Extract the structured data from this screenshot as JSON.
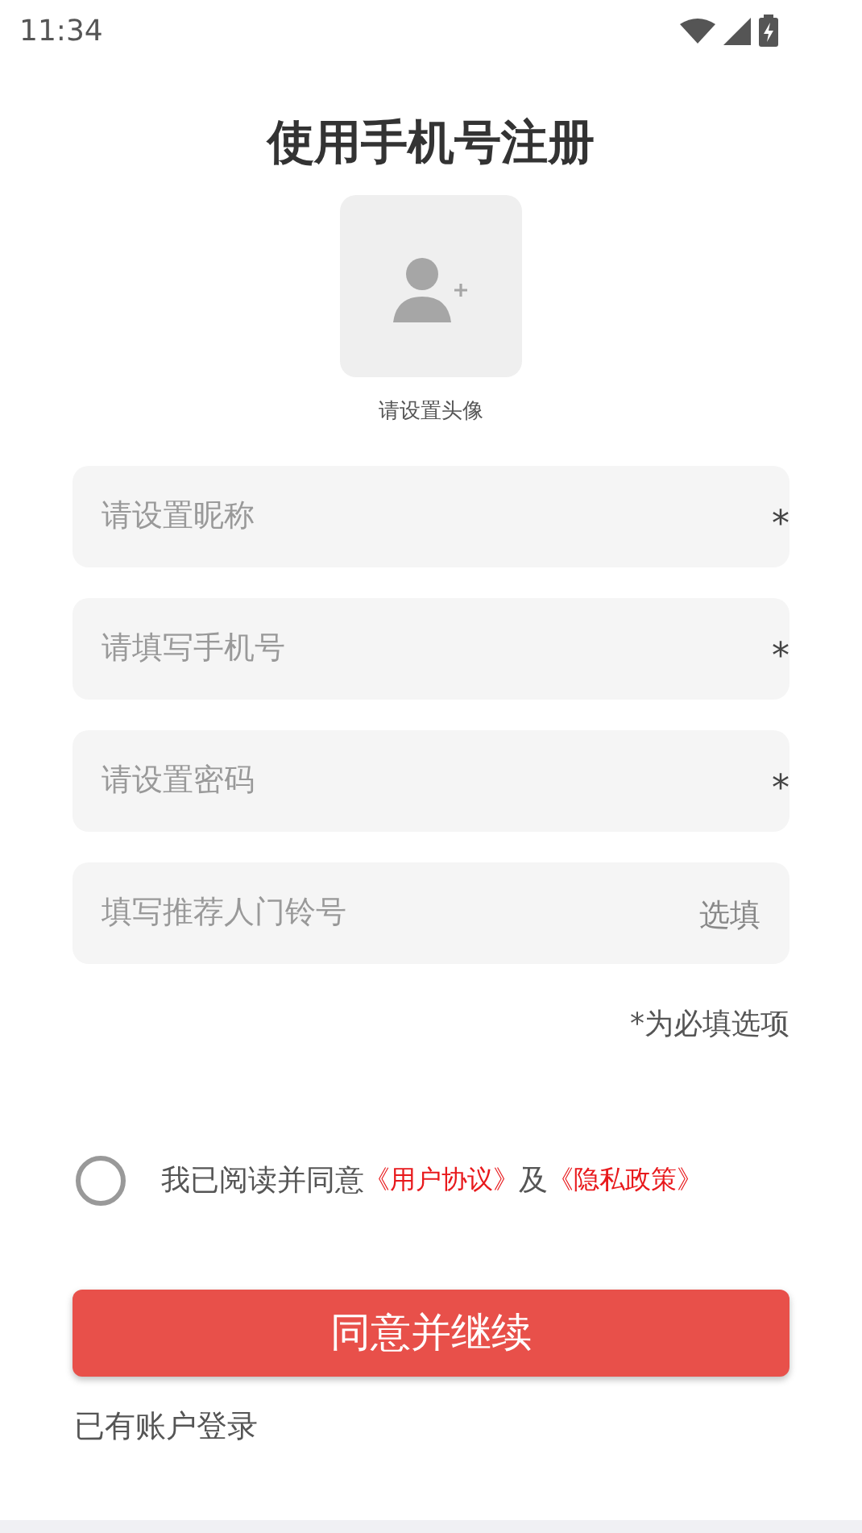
{
  "status_bar": {
    "time": "11:34"
  },
  "title": "使用手机号注册",
  "avatar": {
    "label": "请设置头像"
  },
  "fields": [
    {
      "kind": "required",
      "placeholder": "请设置昵称",
      "suffix": "*"
    },
    {
      "kind": "required",
      "placeholder": "请填写手机号",
      "suffix": "*"
    },
    {
      "kind": "required",
      "placeholder": "请设置密码",
      "suffix": "*"
    },
    {
      "kind": "optional",
      "placeholder": "填写推荐人门铃号",
      "suffix": "选填"
    }
  ],
  "required_note": "*为必填选项",
  "agreement": {
    "checked": false,
    "text": "我已阅读并同意",
    "link_1": "《用户协议》",
    "joiner": "及",
    "link_2": "《隐私政策》"
  },
  "submit_button": "同意并继续",
  "login_link": "已有账户登录"
}
